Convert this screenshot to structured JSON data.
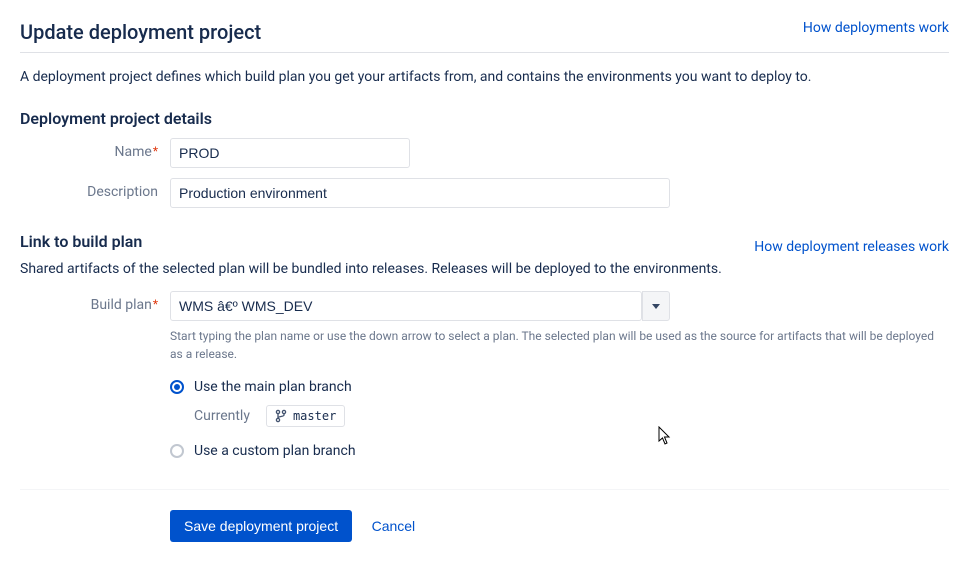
{
  "header": {
    "title": "Update deployment project",
    "help_link": "How deployments work"
  },
  "intro": "A deployment project defines which build plan you get your artifacts from, and contains the environments you want to deploy to.",
  "details": {
    "heading": "Deployment project details",
    "name_label": "Name",
    "name_value": "PROD",
    "description_label": "Description",
    "description_value": "Production environment"
  },
  "link_plan": {
    "heading": "Link to build plan",
    "help_link": "How deployment releases work",
    "description": "Shared artifacts of the selected plan will be bundled into releases. Releases will be deployed to the environments.",
    "build_plan_label": "Build plan",
    "build_plan_value": "WMS â€º WMS_DEV",
    "build_plan_help": "Start typing the plan name or use the down arrow to select a plan. The selected plan will be used as the source for artifacts that will be deployed as a release.",
    "radio_main": "Use the main plan branch",
    "currently_label": "Currently",
    "branch_name": "master",
    "radio_custom": "Use a custom plan branch"
  },
  "actions": {
    "save": "Save deployment project",
    "cancel": "Cancel"
  }
}
